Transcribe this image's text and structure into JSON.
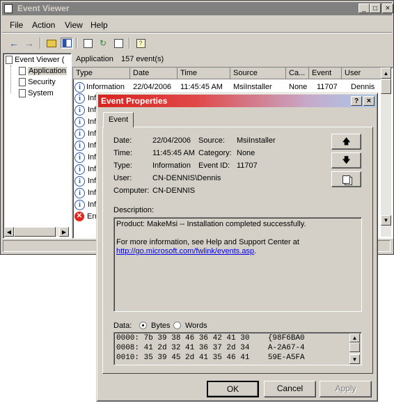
{
  "main_window": {
    "title": "Event Viewer",
    "title_controls": [
      "_",
      "□",
      "×"
    ],
    "menu": [
      "File",
      "Action",
      "View",
      "Help"
    ],
    "tree": {
      "root": "Event Viewer (",
      "items": [
        "Application",
        "Security",
        "System"
      ]
    },
    "list_header": {
      "log_name": "Application",
      "count": "157 event(s)"
    },
    "columns": [
      "Type",
      "Date",
      "Time",
      "Source",
      "Ca...",
      "Event",
      "User"
    ],
    "first_row": {
      "type": "Information",
      "date": "22/04/2006",
      "time": "11:45:45 AM",
      "source": "MsiInstaller",
      "category": "None",
      "event": "11707",
      "user": "Dennis"
    },
    "partial_rows": [
      "Inf",
      "Inf",
      "Inf",
      "Inf",
      "Inf",
      "Inf",
      "Inf",
      "Inf",
      "Inf",
      "Inf",
      "Err"
    ]
  },
  "dialog": {
    "title": "Event Properties",
    "title_controls": [
      "?",
      "×"
    ],
    "tab": "Event",
    "fields": {
      "date_label": "Date:",
      "date_value": "22/04/2006",
      "source_label": "Source:",
      "source_value": "MsiInstaller",
      "time_label": "Time:",
      "time_value": "11:45:45 AM",
      "category_label": "Category:",
      "category_value": "None",
      "type_label": "Type:",
      "type_value": "Information",
      "eventid_label": "Event ID:",
      "eventid_value": "11707",
      "user_label": "User:",
      "user_value": "CN-DENNIS\\Dennis",
      "computer_label": "Computer:",
      "computer_value": "CN-DENNIS"
    },
    "description_label": "Description:",
    "description_line1": "Product: MakeMsi -- Installation completed successfully.",
    "description_line2": "For more information, see Help and Support Center at",
    "description_link": "http://go.microsoft.com/fwlink/events.asp",
    "description_link_suffix": ".",
    "data_label": "Data:",
    "radio_bytes": "Bytes",
    "radio_words": "Words",
    "data_rows": [
      "0000: 7b 39 38 46 36 42 41 30    {98F6BA0",
      "0008: 41 2d 32 41 36 37 2d 34    A-2A67-4",
      "0010: 35 39 45 2d 41 35 46 41    59E-A5FA"
    ],
    "buttons": {
      "ok": "OK",
      "cancel": "Cancel",
      "apply": "Apply"
    }
  }
}
